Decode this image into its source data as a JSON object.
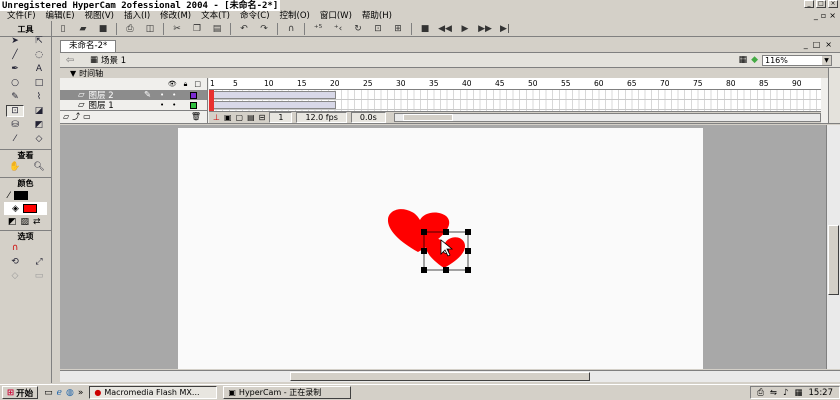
{
  "window": {
    "title": "Unregistered HyperCam 2ofessional 2004 - [未命名-2*]"
  },
  "menu": [
    "文件(F)",
    "编辑(E)",
    "视图(V)",
    "插入(I)",
    "修改(M)",
    "文本(T)",
    "命令(C)",
    "控制(O)",
    "窗口(W)",
    "帮助(H)"
  ],
  "tools": {
    "header": "工具",
    "view_label": "查看",
    "colors_label": "颜色",
    "options_label": "选项"
  },
  "document": {
    "tab": "未命名-2*",
    "scene": "场景 1",
    "zoom": "116%"
  },
  "timeline": {
    "label": "时间轴",
    "ruler_ticks": [
      "1",
      "5",
      "10",
      "15",
      "20",
      "25",
      "30",
      "35",
      "40",
      "45",
      "50",
      "55",
      "60",
      "65",
      "70",
      "75",
      "80",
      "85",
      "90"
    ],
    "layers": [
      {
        "name": "图层 2",
        "color": "#7a2ad0",
        "selected": true
      },
      {
        "name": "图层 1",
        "color": "#30c040",
        "selected": false
      }
    ],
    "current_frame": "1",
    "fps": "12.0 fps",
    "time": "0.0s"
  },
  "stage": {
    "heart_color": "#ff0000",
    "background": "#fafafa"
  },
  "taskbar": {
    "start": "开始",
    "tasks": [
      {
        "label": "Macromedia Flash MX...",
        "active": true
      },
      {
        "label": "HyperCam - 正在录制",
        "active": false
      }
    ],
    "clock": "15:27"
  }
}
